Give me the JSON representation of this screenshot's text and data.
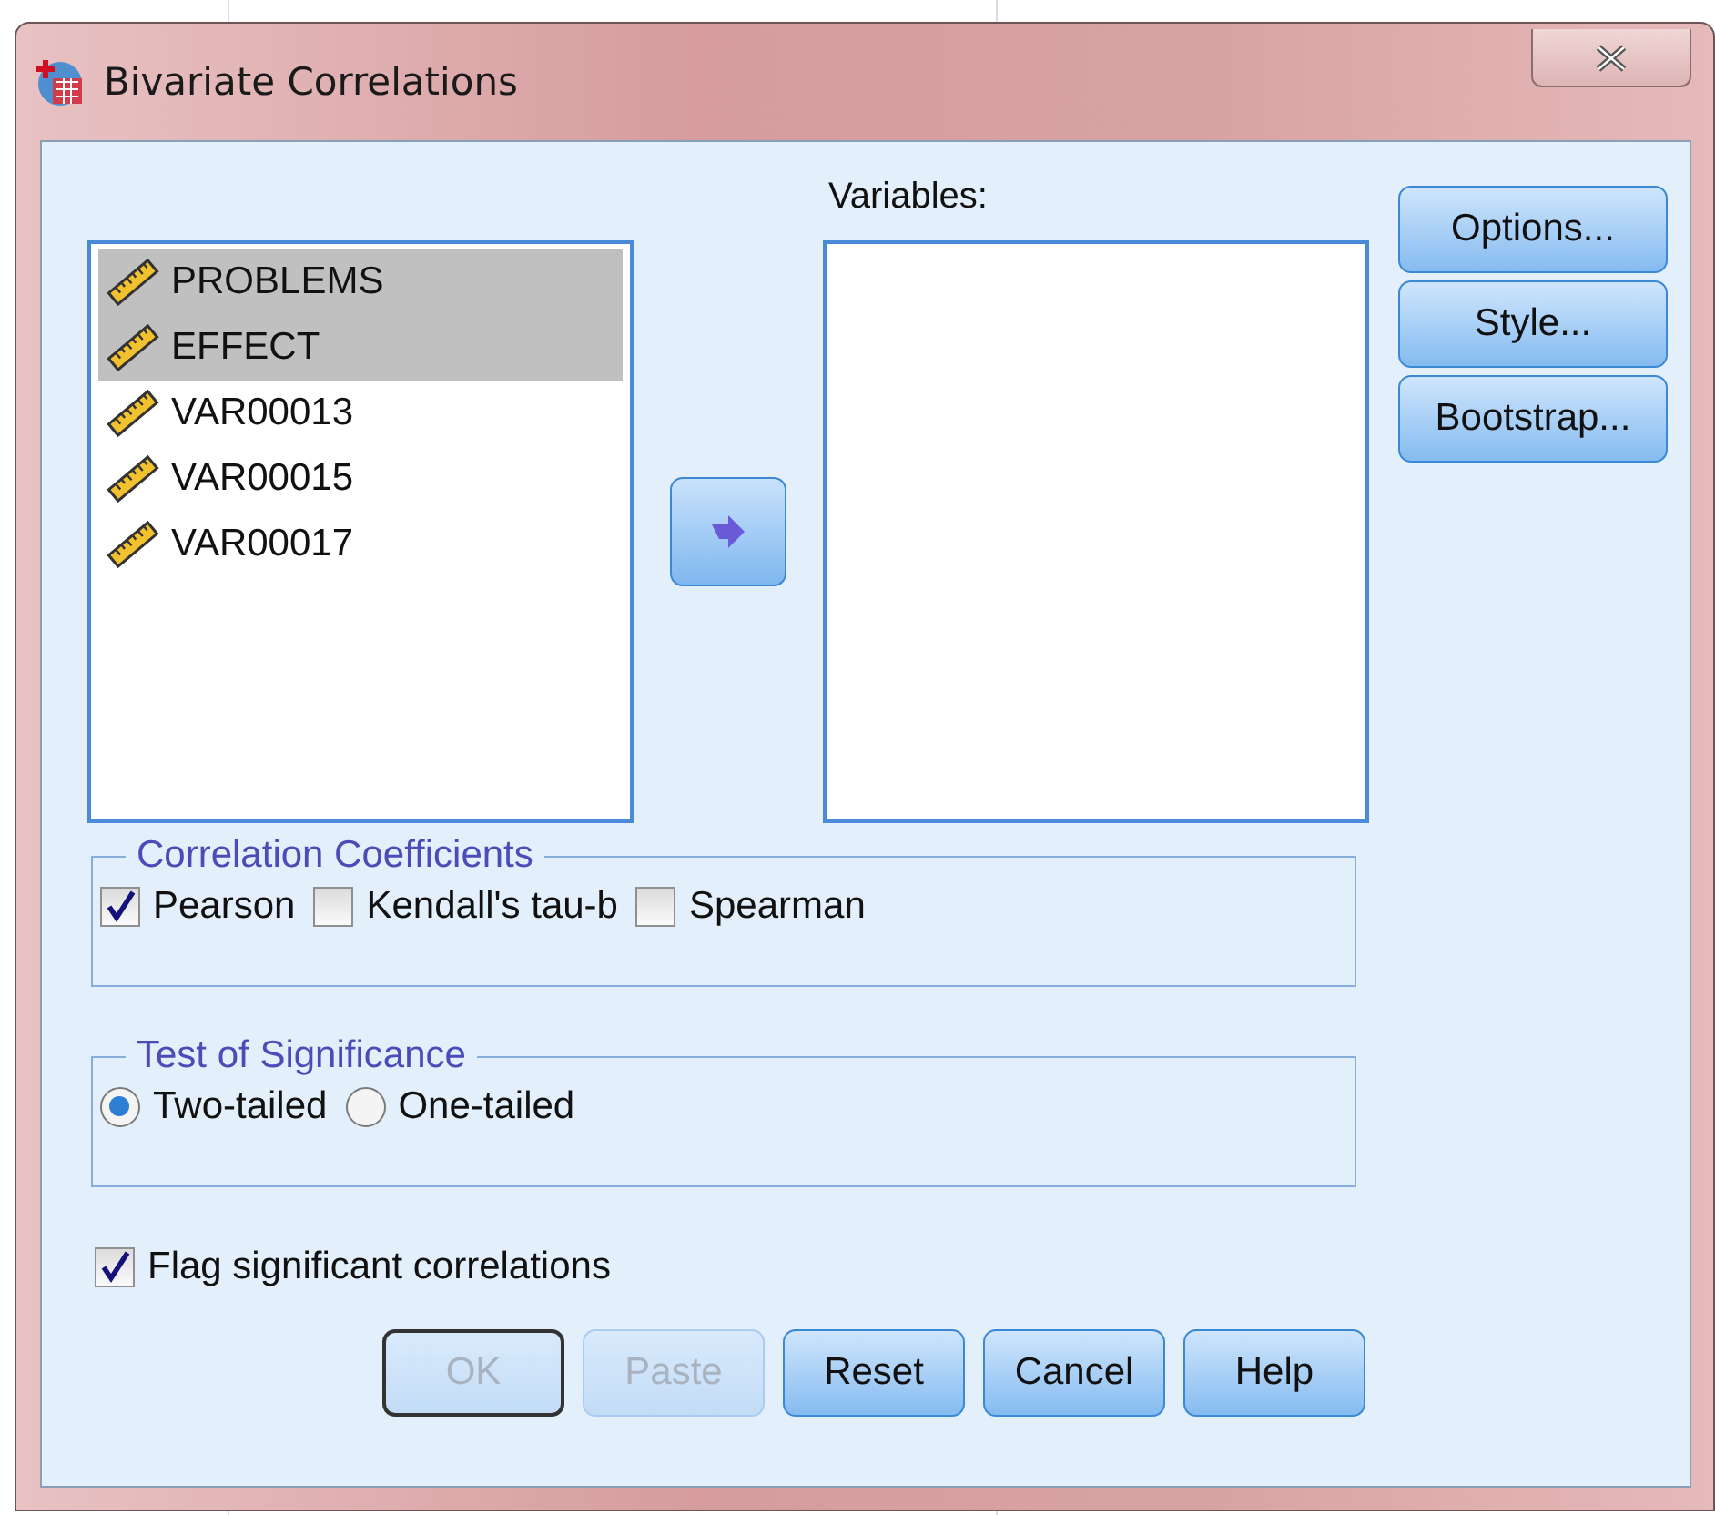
{
  "window": {
    "title": "Bivariate Correlations"
  },
  "source_list": {
    "items": [
      {
        "name": "PROBLEMS",
        "selected": true
      },
      {
        "name": "EFFECT",
        "selected": true
      },
      {
        "name": "VAR00013",
        "selected": false
      },
      {
        "name": "VAR00015",
        "selected": false
      },
      {
        "name": "VAR00017",
        "selected": false
      }
    ]
  },
  "variables": {
    "label": "Variables:"
  },
  "side_buttons": [
    {
      "label": "Options..."
    },
    {
      "label": "Style..."
    },
    {
      "label": "Bootstrap..."
    }
  ],
  "correlation_coefficients": {
    "title": "Correlation Coefficients",
    "options": [
      {
        "label": "Pearson",
        "checked": true
      },
      {
        "label": "Kendall's tau-b",
        "checked": false
      },
      {
        "label": "Spearman",
        "checked": false
      }
    ]
  },
  "test_of_significance": {
    "title": "Test of Significance",
    "options": [
      {
        "label": "Two-tailed",
        "selected": true
      },
      {
        "label": "One-tailed",
        "selected": false
      }
    ]
  },
  "flag_significant": {
    "label": "Flag significant correlations",
    "checked": true
  },
  "buttons": [
    {
      "label": "OK",
      "disabled": true,
      "default": true
    },
    {
      "label": "Paste",
      "disabled": true,
      "default": false
    },
    {
      "label": "Reset",
      "disabled": false,
      "default": false
    },
    {
      "label": "Cancel",
      "disabled": false,
      "default": false
    },
    {
      "label": "Help",
      "disabled": false,
      "default": false
    }
  ]
}
